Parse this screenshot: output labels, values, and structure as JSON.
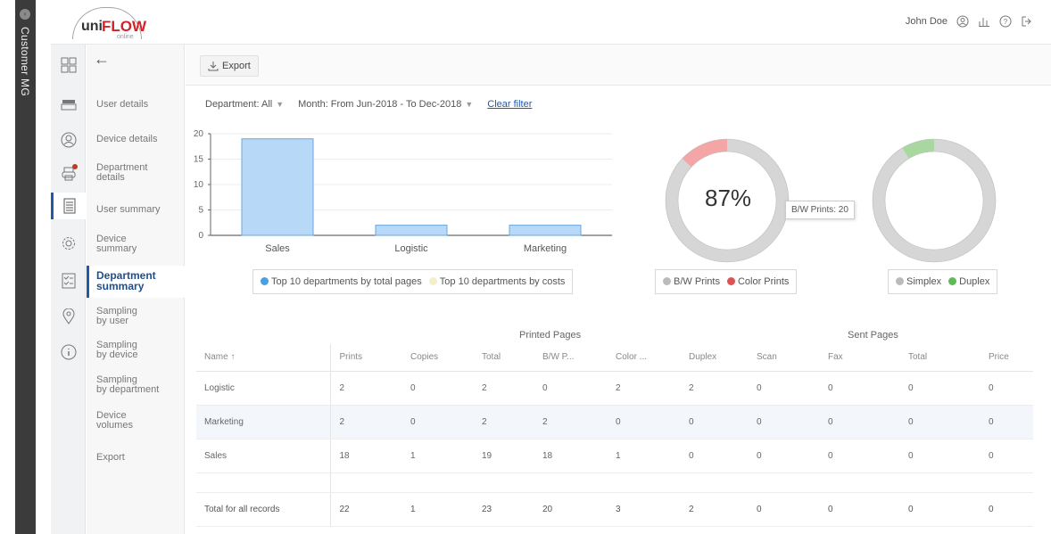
{
  "customer_strip": {
    "label": "Customer MG",
    "icon": "chevron-right-icon"
  },
  "header": {
    "logo": {
      "uni": "uni",
      "flow": "FLOW",
      "online": "online"
    },
    "user_name": "John Doe",
    "icons": [
      "user-circle-icon",
      "chart-icon",
      "help-icon",
      "logout-icon"
    ]
  },
  "rail": {
    "icons": [
      "dashboard-icon",
      "printer-tray-icon",
      "user-circle-icon",
      "printer-icon",
      "document-icon",
      "gear-icon",
      "checklist-icon",
      "location-icon",
      "info-icon"
    ],
    "active_index": 4
  },
  "subnav": {
    "back": "←",
    "items": [
      {
        "label": "User details"
      },
      {
        "label": "Device details"
      },
      {
        "label": "Department\ndetails"
      },
      {
        "label": "User summary"
      },
      {
        "label": "Device\nsummary"
      },
      {
        "label": "Department\nsummary",
        "active": true
      },
      {
        "label": "Sampling\nby user"
      },
      {
        "label": "Sampling\nby device"
      },
      {
        "label": "Sampling\nby department"
      },
      {
        "label": "Device\nvolumes"
      },
      {
        "label": "Export"
      }
    ]
  },
  "toolbar": {
    "export_label": "Export"
  },
  "filters": {
    "department": "Department: All",
    "month": "Month: From Jun-2018 - To Dec-2018",
    "clear": "Clear filter"
  },
  "chart_data": [
    {
      "type": "bar",
      "categories": [
        "Sales",
        "Logistic",
        "Marketing"
      ],
      "values": [
        19,
        2,
        2
      ],
      "ylim": [
        0,
        20
      ],
      "yticks": [
        0,
        5,
        10,
        15,
        20
      ],
      "color": "#b7d8f7",
      "legend": [
        "Top 10 departments by total pages",
        "Top 10 departments by costs"
      ]
    },
    {
      "type": "pie",
      "center_label": "87%",
      "slices": [
        {
          "name": "B/W Prints",
          "value": 20,
          "color": "#d6d6d6"
        },
        {
          "name": "Color Prints",
          "value": 3,
          "color": "#f4a6a6"
        }
      ],
      "tooltip": "B/W Prints: 20"
    },
    {
      "type": "pie",
      "slices": [
        {
          "name": "Simplex",
          "value": 21,
          "color": "#d6d6d6"
        },
        {
          "name": "Duplex",
          "value": 2,
          "color": "#a8d8a0"
        }
      ]
    }
  ],
  "table": {
    "group_printed": "Printed Pages",
    "group_sent": "Sent Pages",
    "columns": [
      "Name ↑",
      "Prints",
      "Copies",
      "Total",
      "B/W P...",
      "Color ...",
      "Duplex",
      "Scan",
      "Fax",
      "Total",
      "Price"
    ],
    "rows": [
      [
        "Logistic",
        "2",
        "0",
        "2",
        "0",
        "2",
        "2",
        "0",
        "0",
        "0",
        "0"
      ],
      [
        "Marketing",
        "2",
        "0",
        "2",
        "2",
        "0",
        "0",
        "0",
        "0",
        "0",
        "0"
      ],
      [
        "Sales",
        "18",
        "1",
        "19",
        "18",
        "1",
        "0",
        "0",
        "0",
        "0",
        "0"
      ]
    ],
    "total_row": [
      "Total for all records",
      "22",
      "1",
      "23",
      "20",
      "3",
      "2",
      "0",
      "0",
      "0",
      "0"
    ]
  },
  "colors": {
    "accent": "#1e5aa8",
    "brand_red": "#d2232a"
  }
}
